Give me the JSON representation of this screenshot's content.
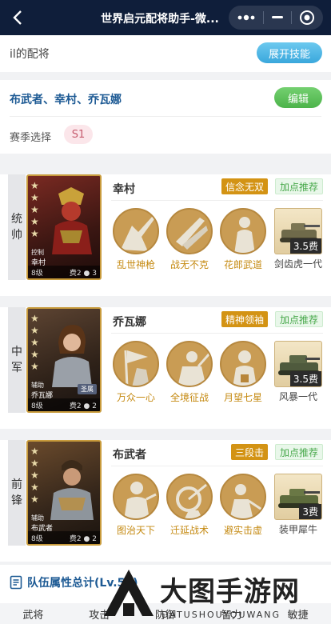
{
  "titlebar": {
    "title": "世界启元配将助手-微..."
  },
  "header": {
    "label": "il的配将",
    "expand_button": "展开技能"
  },
  "team": {
    "name": "布武者、幸村、乔瓦娜",
    "edit_button": "编辑",
    "season_label": "赛季选择",
    "season_value": "S1"
  },
  "heroes": [
    {
      "position": [
        "统",
        "帅"
      ],
      "name": "幸村",
      "trait": "信念无双",
      "recommend": "加点推荐",
      "card": {
        "role": "控制",
        "name": "幸村",
        "level": "8级",
        "cost": "费2",
        "count": "3"
      },
      "skills": [
        "乱世神枪",
        "战无不克",
        "花郎武道"
      ],
      "tank": {
        "cost": "3.5费",
        "name": "剑齿虎一代"
      }
    },
    {
      "position": [
        "中",
        "军"
      ],
      "name": "乔瓦娜",
      "trait": "精神领袖",
      "recommend": "加点推荐",
      "card": {
        "role": "辅助",
        "name": "乔瓦娜",
        "level": "8级",
        "cost": "费2",
        "count": "2",
        "badge": "圣属"
      },
      "skills": [
        "万众一心",
        "全境征战",
        "月望七星"
      ],
      "tank": {
        "cost": "3.5费",
        "name": "风暴一代"
      }
    },
    {
      "position": [
        "前",
        "锋"
      ],
      "name": "布武者",
      "trait": "三段击",
      "recommend": "加点推荐",
      "card": {
        "role": "辅助",
        "name": "布武者",
        "level": "8级",
        "cost": "费2",
        "count": "2"
      },
      "skills": [
        "图治天下",
        "迁延战术",
        "避实击虚"
      ],
      "tank": {
        "cost": "3费",
        "name": "装甲犀牛"
      }
    }
  ],
  "stats": {
    "title": "队伍属性总计(Lv.50)",
    "columns": [
      "武将",
      "攻击",
      "防御",
      "智力",
      "敏捷"
    ]
  },
  "watermark": {
    "text": "大图手游网",
    "sub": "DATUSHOUYOUWANG"
  },
  "colors": {
    "titlebar": "#0f1e3a",
    "accent_blue": "#1d5a94",
    "gold": "#d39314",
    "green": "#4cb34a"
  }
}
